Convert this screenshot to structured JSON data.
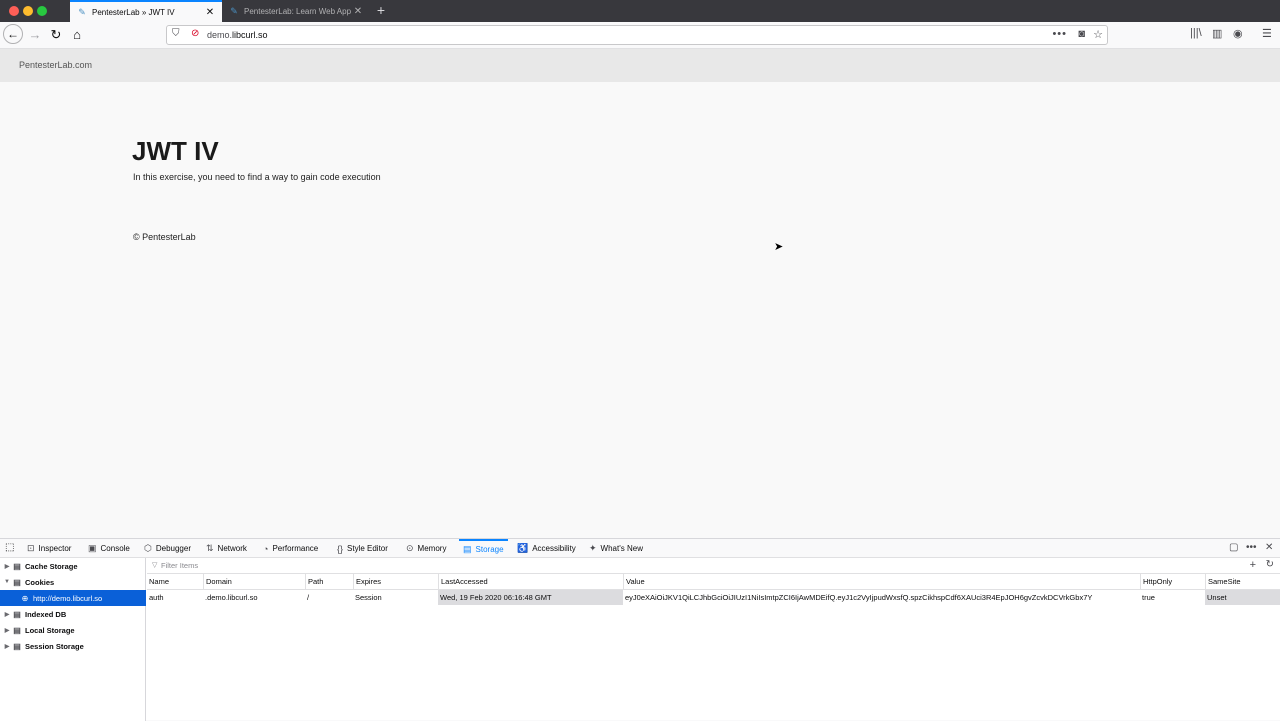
{
  "browser": {
    "tabs": [
      {
        "title": "PentesterLab » JWT IV",
        "active": true
      },
      {
        "title": "PentesterLab: Learn Web App Pen",
        "active": false
      }
    ],
    "url": {
      "prefix": "demo.",
      "domain": "libcurl.so"
    }
  },
  "page": {
    "brand": "PentesterLab.com",
    "title": "JWT IV",
    "description": "In this exercise, you need to find a way to gain code execution",
    "footer": "© PentesterLab"
  },
  "devtools": {
    "tabs": [
      {
        "label": "Inspector",
        "icon": "inspector-icon",
        "glyph": "⊡"
      },
      {
        "label": "Console",
        "icon": "console-icon",
        "glyph": "▣"
      },
      {
        "label": "Debugger",
        "icon": "debugger-icon",
        "glyph": "⬡"
      },
      {
        "label": "Network",
        "icon": "network-icon",
        "glyph": "⇅"
      },
      {
        "label": "Performance",
        "icon": "performance-icon",
        "glyph": "◔"
      },
      {
        "label": "Style Editor",
        "icon": "style-editor-icon",
        "glyph": "{}"
      },
      {
        "label": "Memory",
        "icon": "memory-icon",
        "glyph": "⊙"
      },
      {
        "label": "Storage",
        "icon": "storage-icon",
        "glyph": "▤",
        "selected": true
      },
      {
        "label": "Accessibility",
        "icon": "accessibility-icon",
        "glyph": "♿"
      },
      {
        "label": "What's New",
        "icon": "whats-new-icon",
        "glyph": "🎁"
      }
    ],
    "storage_tree": [
      {
        "label": "Cache Storage",
        "expanded": false
      },
      {
        "label": "Cookies",
        "expanded": true
      },
      {
        "label": "http://demo.libcurl.so",
        "child": true,
        "selected": true
      },
      {
        "label": "Indexed DB",
        "expanded": false
      },
      {
        "label": "Local Storage",
        "expanded": false
      },
      {
        "label": "Session Storage",
        "expanded": false
      }
    ],
    "filter_placeholder": "Filter Items",
    "columns": [
      "Name",
      "Domain",
      "Path",
      "Expires",
      "LastAccessed",
      "Value",
      "HttpOnly",
      "SameSite"
    ],
    "rows": [
      {
        "name": "auth",
        "domain": ".demo.libcurl.so",
        "path": "/",
        "expires": "Session",
        "last_accessed": "Wed, 19 Feb 2020 06:16:48 GMT",
        "value": "eyJ0eXAiOiJKV1QiLCJhbGciOiJIUzI1NiIsImtpZCI6IjAwMDEifQ.eyJ1c2VyIjpudWxsfQ.spzCikhspCdf6XAUci3R4EpJOH6gvZcvkDCVrkGbx7Y",
        "http_only": "true",
        "same_site": "Unset"
      }
    ]
  },
  "colors": {
    "accent": "#0a84ff",
    "selection": "#0a60d8",
    "tabstrip": "#38383d"
  }
}
